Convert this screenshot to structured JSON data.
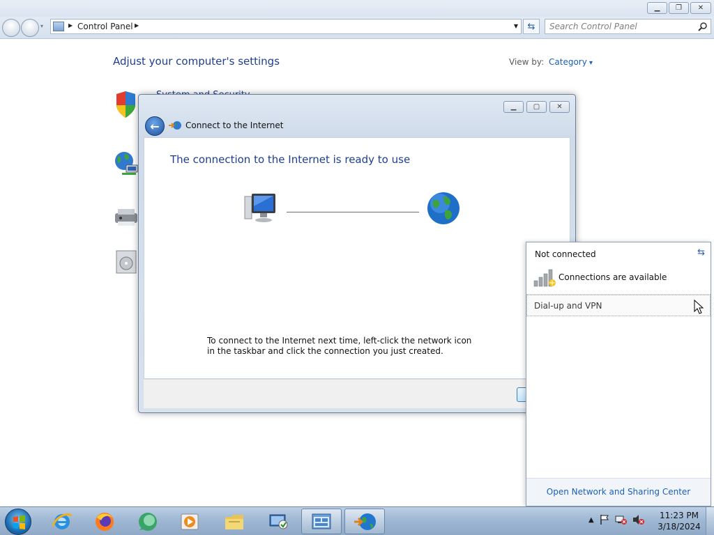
{
  "explorer": {
    "address_crumb": "Control Panel",
    "search_placeholder": "Search Control Panel"
  },
  "control_panel": {
    "title": "Adjust your computer's settings",
    "view_by_label": "View by:",
    "view_by_value": "Category",
    "partial_category": "System and Security"
  },
  "wizard": {
    "title": "Connect to the Internet",
    "heading": "The connection to the Internet is ready to use",
    "instructions": "To connect to the Internet next time, left-click the network icon in the taskbar and click the connection you just created."
  },
  "network_flyout": {
    "status": "Not connected",
    "availability": "Connections are available",
    "item": "Dial-up and VPN",
    "footer_link": "Open Network and Sharing Center"
  },
  "taskbar": {
    "apps": [
      "internet-explorer-icon",
      "firefox-icon",
      "chat-icon",
      "media-player-icon",
      "file-explorer-icon",
      "remote-desktop-icon",
      "control-panel-icon",
      "network-wizard-icon"
    ],
    "clock_time": "11:23 PM",
    "clock_date": "3/18/2024"
  }
}
